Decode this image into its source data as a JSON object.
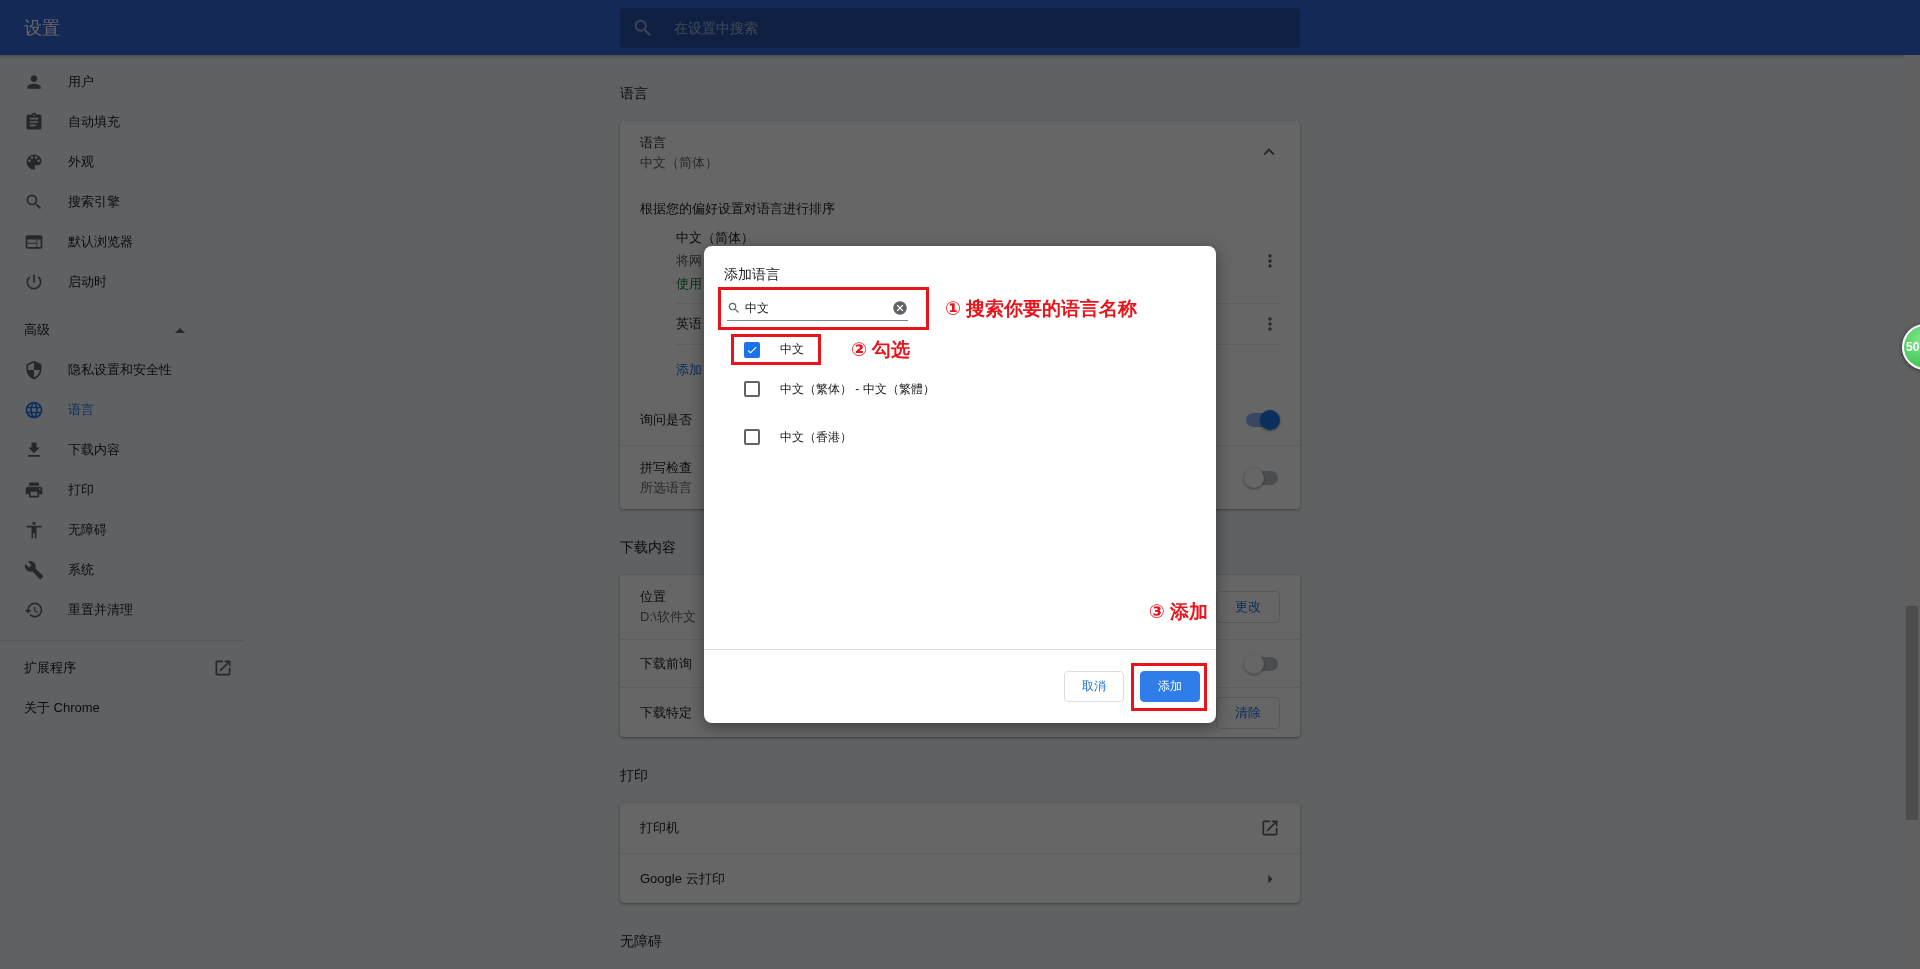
{
  "header": {
    "title": "设置",
    "search": {
      "placeholder": "在设置中搜索"
    }
  },
  "sidebar": {
    "items": [
      {
        "label": "用户",
        "selected": false
      },
      {
        "label": "自动填充",
        "selected": false
      },
      {
        "label": "外观",
        "selected": false
      },
      {
        "label": "搜索引擎",
        "selected": false
      },
      {
        "label": "默认浏览器",
        "selected": false
      },
      {
        "label": "启动时",
        "selected": false
      }
    ],
    "advanced": {
      "label": "高级",
      "expanded": true
    },
    "advanced_items": [
      {
        "label": "隐私设置和安全性",
        "selected": false
      },
      {
        "label": "语言",
        "selected": true
      },
      {
        "label": "下载内容",
        "selected": false
      },
      {
        "label": "打印",
        "selected": false
      },
      {
        "label": "无障碍",
        "selected": false
      },
      {
        "label": "系统",
        "selected": false
      },
      {
        "label": "重置并清理",
        "selected": false
      }
    ],
    "footer": [
      {
        "label": "扩展程序",
        "kind": "external"
      },
      {
        "label": "关于 Chrome",
        "kind": "plain"
      }
    ]
  },
  "language_section": {
    "heading": "语言",
    "card": {
      "title": "语言",
      "value": "中文（简体）",
      "expanded": true,
      "sort_hint": "根据您的偏好设置对语言进行排序",
      "languages": [
        {
          "name": "中文（简体）",
          "detail": "将网",
          "status": "使用"
        },
        {
          "name": "英语"
        }
      ],
      "add_link": "添加",
      "translate": {
        "label": "询问是否",
        "on": true
      },
      "spellcheck": {
        "label": "拼写检查",
        "detail": "所选语言",
        "on": false
      }
    }
  },
  "downloads_section": {
    "heading": "下载内容",
    "rows": [
      {
        "kind": "button",
        "label": "位置",
        "detail": "D:\\软件文",
        "button": "更改"
      },
      {
        "kind": "toggle",
        "label": "下载前询",
        "on": false
      },
      {
        "kind": "button",
        "label": "下载特定",
        "button": "清除"
      }
    ]
  },
  "print_section": {
    "heading": "打印",
    "rows": [
      {
        "kind": "external",
        "label": "打印机"
      },
      {
        "kind": "arrow",
        "label": "Google 云打印"
      }
    ]
  },
  "accessibility_section": {
    "heading": "无障碍"
  },
  "dialog": {
    "title": "添加语言",
    "search": {
      "value": "中文",
      "highlighted": true
    },
    "options": [
      {
        "label": "中文",
        "checked": true,
        "highlighted": true
      },
      {
        "label": "中文（繁体） - 中文（繁體）",
        "checked": false,
        "highlighted": false
      },
      {
        "label": "中文（香港）",
        "checked": false,
        "highlighted": false
      }
    ],
    "buttons": [
      {
        "label": "取消",
        "kind": "secondary",
        "highlighted": false
      },
      {
        "label": "添加",
        "kind": "primary",
        "highlighted": true
      }
    ],
    "annotations": [
      {
        "text": "① 搜索你要的语言名称"
      },
      {
        "text": "② 勾选"
      },
      {
        "text": "③ 添加"
      }
    ]
  },
  "floating_badge": {
    "text": "50"
  }
}
